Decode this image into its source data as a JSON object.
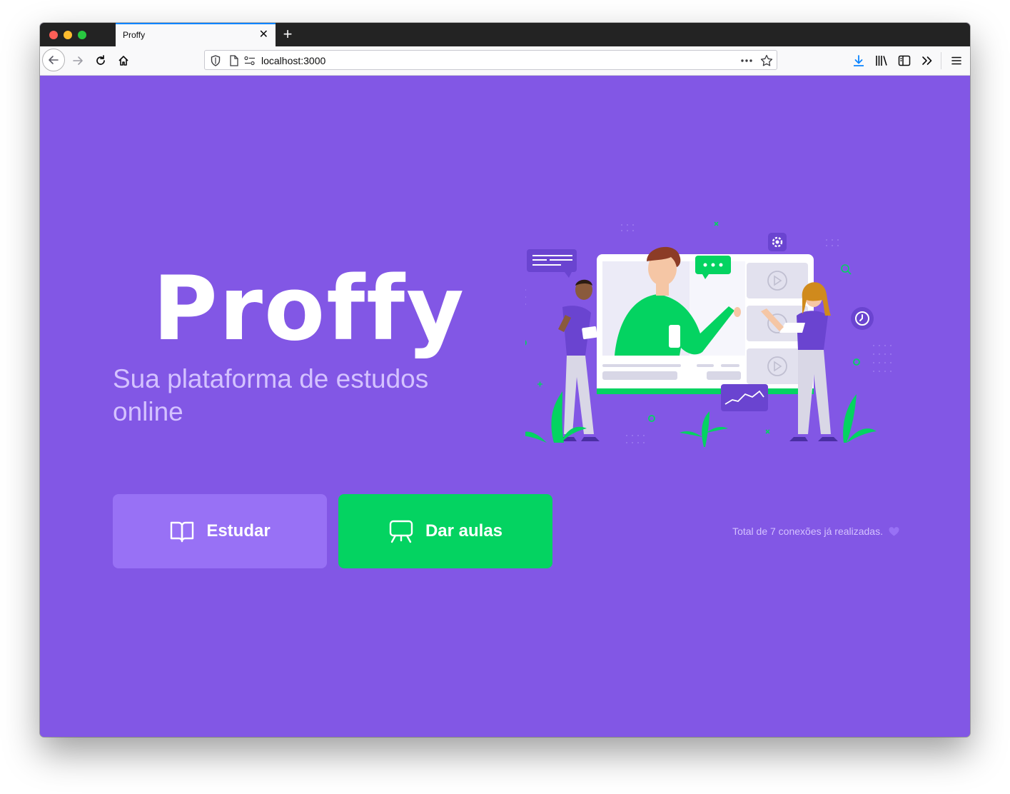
{
  "browser": {
    "tab_title": "Proffy",
    "url": "localhost:3000"
  },
  "page": {
    "logo_text": "Proffy",
    "tagline": "Sua plataforma de estudos online",
    "buttons": {
      "study_label": "Estudar",
      "teach_label": "Dar aulas"
    },
    "connections_text": "Total de 7 conexões já realizadas.",
    "colors": {
      "background": "#8257e5",
      "study_button": "#9871f5",
      "teach_button": "#04d361",
      "tagline": "#d4c2ff"
    }
  }
}
